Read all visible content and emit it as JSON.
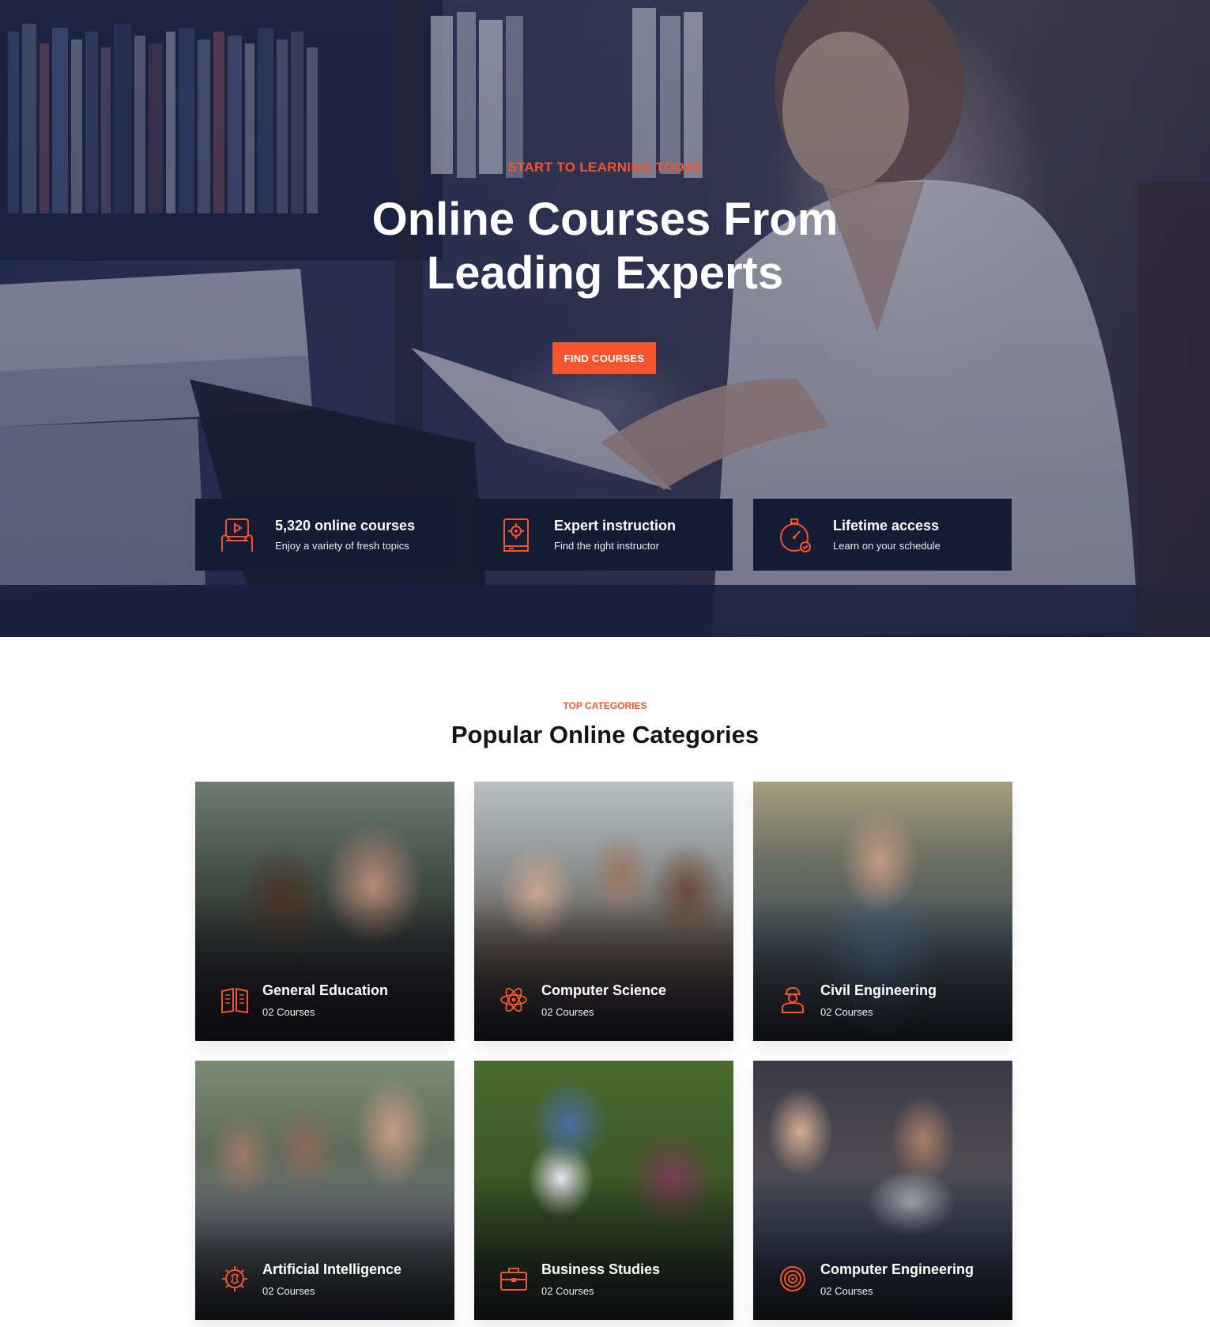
{
  "hero": {
    "kicker": "START TO LEARNING TODAY",
    "title_line1": "Online Courses From",
    "title_line2": "Leading Experts",
    "cta_label": "FIND COURSES"
  },
  "features": [
    {
      "icon": "video-lesson-icon",
      "title": "5,320 online courses",
      "subtitle": "Enjoy a variety of fresh topics"
    },
    {
      "icon": "gear-book-icon",
      "title": "Expert instruction",
      "subtitle": "Find the right instructor"
    },
    {
      "icon": "stopwatch-icon",
      "title": "Lifetime access",
      "subtitle": "Learn on your schedule"
    }
  ],
  "categories_section": {
    "kicker": "TOP CATEGORIES",
    "title": "Popular Online Categories",
    "items": [
      {
        "name": "General Education",
        "count": "02 Courses",
        "icon": "open-book-icon"
      },
      {
        "name": "Computer Science",
        "count": "02 Courses",
        "icon": "atom-icon"
      },
      {
        "name": "Civil Engineering",
        "count": "02 Courses",
        "icon": "engineer-icon"
      },
      {
        "name": "Artificial Intelligence",
        "count": "02 Courses",
        "icon": "brain-gear-icon"
      },
      {
        "name": "Business Studies",
        "count": "02 Courses",
        "icon": "briefcase-icon"
      },
      {
        "name": "Computer Engineering",
        "count": "02 Courses",
        "icon": "target-icon"
      }
    ]
  },
  "colors": {
    "accent": "#f4552c",
    "feature_bg": "#151c33",
    "heading": "#141414"
  }
}
